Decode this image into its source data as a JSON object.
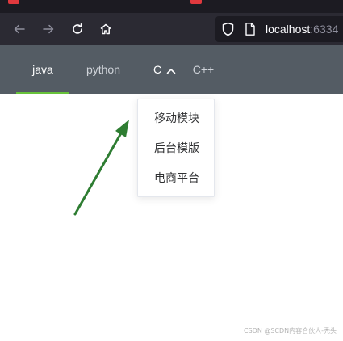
{
  "browser": {
    "url_host": "localhost",
    "url_port": ":6334",
    "icons": {
      "back": "back-arrow-icon",
      "forward": "forward-arrow-icon",
      "reload": "reload-icon",
      "home": "home-icon",
      "shield": "shield-icon",
      "page": "page-icon"
    }
  },
  "menu": {
    "items": [
      {
        "label": "java",
        "active": true
      },
      {
        "label": "python",
        "active": false
      },
      {
        "label": "C",
        "active": false,
        "open": true
      },
      {
        "label": "C++",
        "active": false
      }
    ],
    "submenu": {
      "items": [
        "移动模块",
        "后台模版",
        "电商平台"
      ]
    }
  },
  "annotation": {
    "arrow_color": "#2e7d32"
  },
  "colors": {
    "menu_bg": "#545c64",
    "active_underline": "#67c23a",
    "toolbar_bg": "#2b2a33"
  },
  "watermark": "CSDN @SCDN内容合伙人-秃头"
}
